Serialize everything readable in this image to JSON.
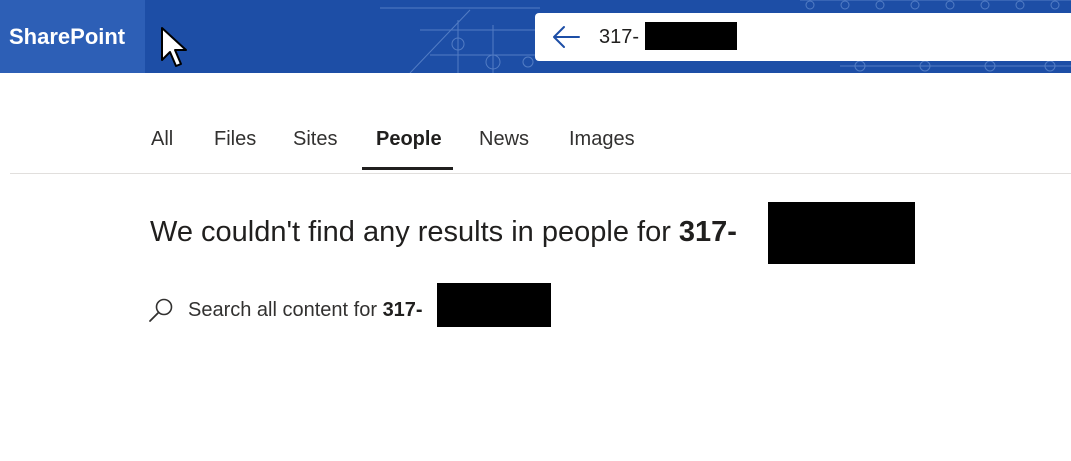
{
  "header": {
    "brand": "SharePoint",
    "search_query": "317-",
    "colors": {
      "bar": "#1d4ea6",
      "brand_tile": "#2d5fb6"
    }
  },
  "icons": {
    "back": "back-arrow-icon",
    "search": "search-icon",
    "cursor": "mouse-pointer-icon"
  },
  "tabs": [
    {
      "label": "All",
      "active": false
    },
    {
      "label": "Files",
      "active": false
    },
    {
      "label": "Sites",
      "active": false
    },
    {
      "label": "People",
      "active": true
    },
    {
      "label": "News",
      "active": false
    },
    {
      "label": "Images",
      "active": false
    }
  ],
  "results": {
    "no_results_prefix": "We couldn't find any results in people for ",
    "query": "317-",
    "search_all_prefix": "Search all content for ",
    "search_all_query": "317-"
  }
}
